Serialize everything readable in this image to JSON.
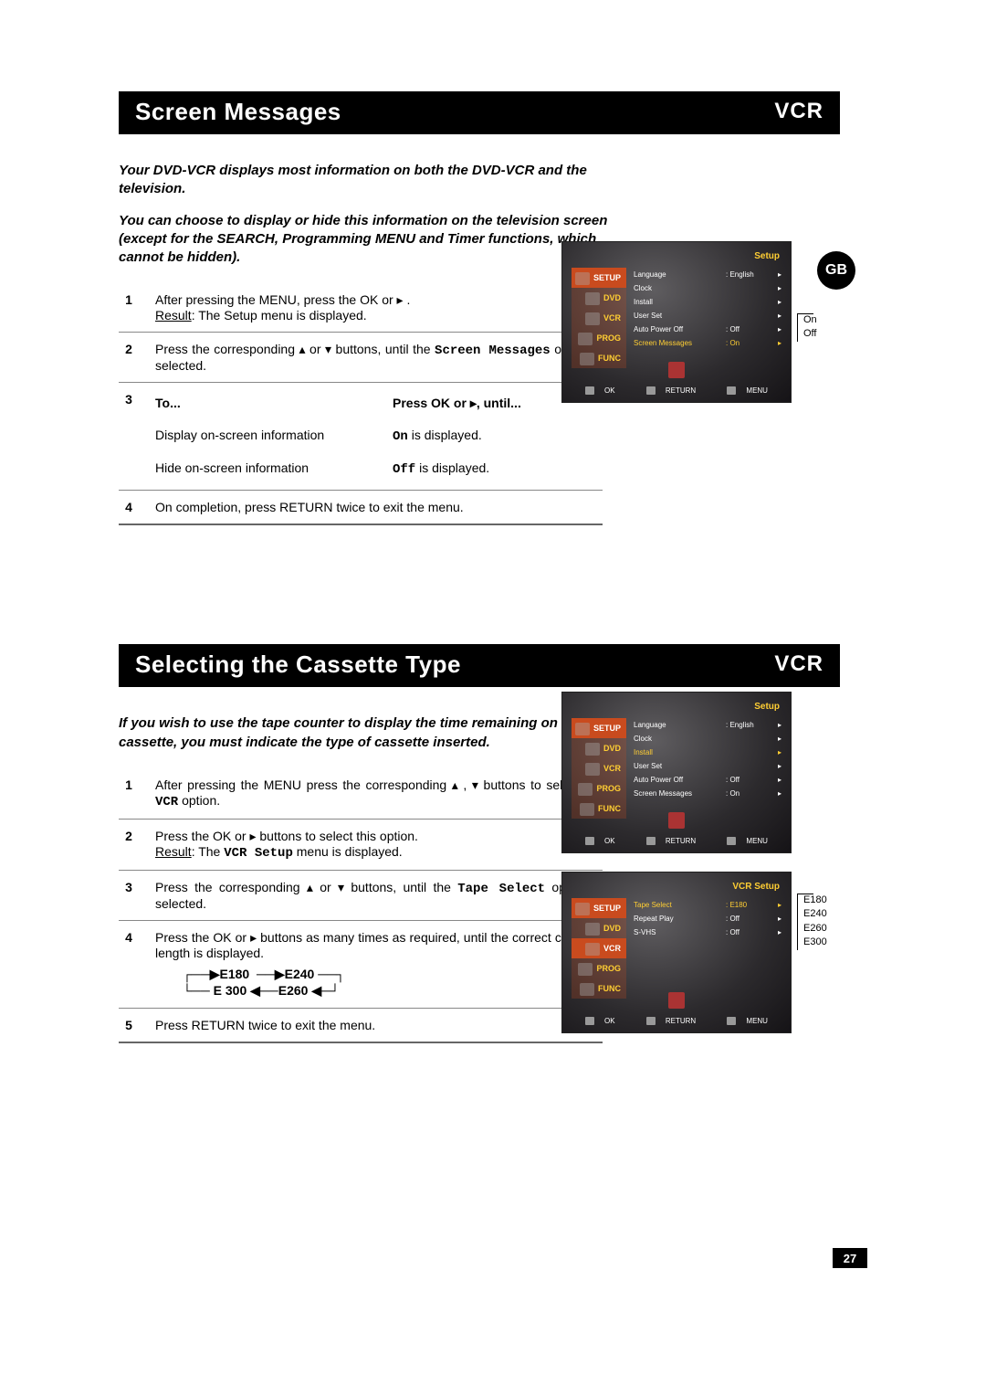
{
  "section1": {
    "title": "Screen Messages",
    "badge": "VCR",
    "intro1": "Your DVD-VCR displays most information on both the DVD-VCR and the television.",
    "intro2": "You can choose to display or hide this information on the television screen (except for the SEARCH, Programming MENU and Timer functions, which cannot be hidden).",
    "step1_a": "After pressing the MENU, press the OK or ▸ .",
    "step1_result_label": "Result",
    "step1_result": ":     The Setup menu is displayed.",
    "step2_a": "Press the corresponding ▴ or ▾ buttons, until the ",
    "step2_mono": "Screen Messages",
    "step2_b": " option is selected.",
    "step3_to": "To...",
    "step3_press": "Press OK or ▸, until...",
    "step3_r1_c1": "Display on-screen information",
    "step3_r1_c2a": "On",
    "step3_r1_c2b": " is displayed.",
    "step3_r2_c1": "Hide on-screen information",
    "step3_r2_c2a": "Off",
    "step3_r2_c2b": " is displayed.",
    "step4": "On completion, press RETURN twice to exit the menu.",
    "osd": {
      "header": "Setup",
      "tabs": [
        "SETUP",
        "DVD",
        "VCR",
        "PROG",
        "FUNC"
      ],
      "rows": [
        {
          "lbl": "Language",
          "val": ": English",
          "arr": "▸",
          "hl": false
        },
        {
          "lbl": "Clock",
          "val": "",
          "arr": "▸",
          "hl": false
        },
        {
          "lbl": "Install",
          "val": "",
          "arr": "▸",
          "hl": false
        },
        {
          "lbl": "User Set",
          "val": "",
          "arr": "▸",
          "hl": false
        },
        {
          "lbl": "Auto Power Off",
          "val": ": Off",
          "arr": "▸",
          "hl": false
        },
        {
          "lbl": "Screen Messages",
          "val": ": On",
          "arr": "▸",
          "hl": true
        }
      ],
      "foot": {
        "ok": "OK",
        "ret": "RETURN",
        "menu": "MENU"
      }
    },
    "side_note": {
      "a": "On",
      "b": "Off"
    },
    "gb": "GB"
  },
  "section2": {
    "title": "Selecting the Cassette Type",
    "badge": "VCR",
    "intro": "If you wish to use the tape counter to display the time remaining on a cassette, you must indicate the type of cassette inserted.",
    "step1_a": "After pressing the MENU press the corresponding ▴ , ▾ buttons to select the ",
    "step1_mono": "VCR",
    "step1_b": "  option.",
    "step2_a": "Press the OK or ▸ buttons to select this option.",
    "step2_result_label": "Result",
    "step2_result_a": ":     The ",
    "step2_mono": "VCR  Setup",
    "step2_result_b": " menu is displayed.",
    "step3_a": "Press the corresponding ▴ or ▾ buttons, until the ",
    "step3_mono": "Tape Select",
    "step3_b": " option is selected.",
    "step4_a": "Press the OK or ▸ buttons as many times as required, until the correct cassette length is displayed.",
    "cycle_l1": "┌──▶E180  ──▶E240 ──┐",
    "cycle_l2": "└── E 300 ◀──E260 ◀─┘",
    "step5": "Press RETURN twice to exit the menu.",
    "osd_a": {
      "header": "Setup",
      "tabs": [
        "SETUP",
        "DVD",
        "VCR",
        "PROG",
        "FUNC"
      ],
      "rows": [
        {
          "lbl": "Language",
          "val": ": English",
          "arr": "▸",
          "hl": false
        },
        {
          "lbl": "Clock",
          "val": "",
          "arr": "▸",
          "hl": false
        },
        {
          "lbl": "Install",
          "val": "",
          "arr": "▸",
          "hl": true
        },
        {
          "lbl": "User Set",
          "val": "",
          "arr": "▸",
          "hl": false
        },
        {
          "lbl": "Auto Power Off",
          "val": ": Off",
          "arr": "▸",
          "hl": false
        },
        {
          "lbl": "Screen Messages",
          "val": ": On",
          "arr": "▸",
          "hl": false
        }
      ],
      "foot": {
        "ok": "OK",
        "ret": "RETURN",
        "menu": "MENU"
      }
    },
    "osd_b": {
      "header": "VCR Setup",
      "tabs": [
        "SETUP",
        "DVD",
        "VCR",
        "PROG",
        "FUNC"
      ],
      "rows": [
        {
          "lbl": "Tape Select",
          "val": ": E180",
          "arr": "▸",
          "hl": true
        },
        {
          "lbl": "Repeat Play",
          "val": ": Off",
          "arr": "▸",
          "hl": false
        },
        {
          "lbl": "S-VHS",
          "val": ": Off",
          "arr": "▸",
          "hl": false
        }
      ],
      "foot": {
        "ok": "OK",
        "ret": "RETURN",
        "menu": "MENU"
      }
    },
    "side_note": {
      "a": "E180",
      "b": "E240",
      "c": "E260",
      "d": "E300"
    }
  },
  "page_number": "27"
}
